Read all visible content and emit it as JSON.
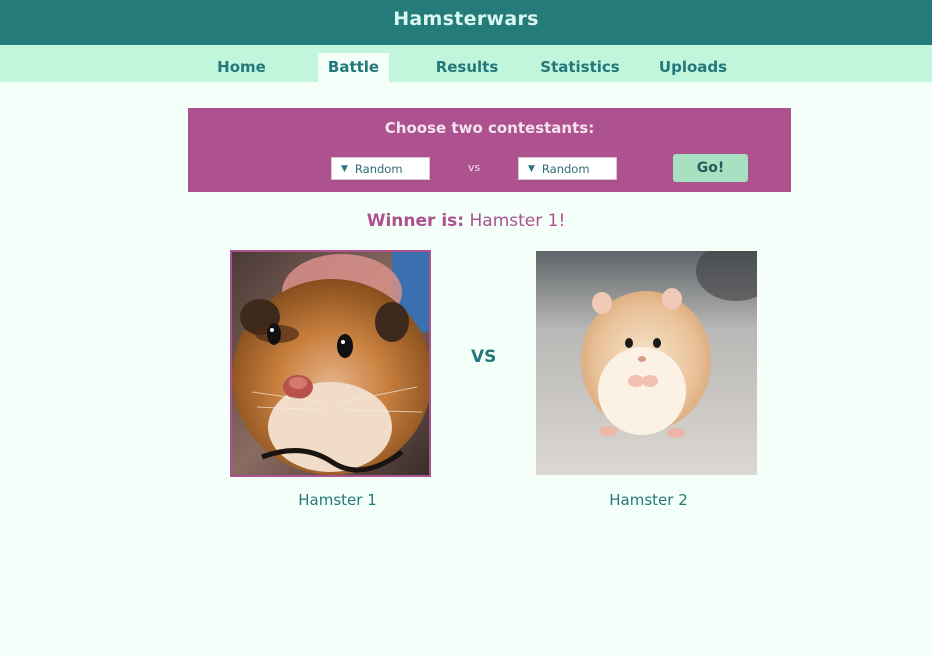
{
  "header": {
    "title": "Hamsterwars"
  },
  "nav": {
    "items": [
      {
        "label": "Home"
      },
      {
        "label": "Battle",
        "active": true
      },
      {
        "label": "Results"
      },
      {
        "label": "Statistics"
      },
      {
        "label": "Uploads"
      }
    ]
  },
  "chooser": {
    "title": "Choose two contestants:",
    "left_select": {
      "value": "Random"
    },
    "vs_label": "vs",
    "right_select": {
      "value": "Random"
    },
    "go_label": "Go!"
  },
  "result": {
    "winner_label": "Winner is:",
    "winner_name": "Hamster 1!"
  },
  "battle": {
    "vs_label": "VS",
    "contestants": [
      {
        "name": "Hamster 1",
        "winner": true
      },
      {
        "name": "Hamster 2",
        "winner": false
      }
    ]
  },
  "colors": {
    "header_bg": "#257a7a",
    "nav_bg": "#c1f6dc",
    "accent_magenta": "#ad518f",
    "teal_text": "#24777a",
    "go_button": "#a7e1c1",
    "page_bg": "#f4fffa"
  }
}
